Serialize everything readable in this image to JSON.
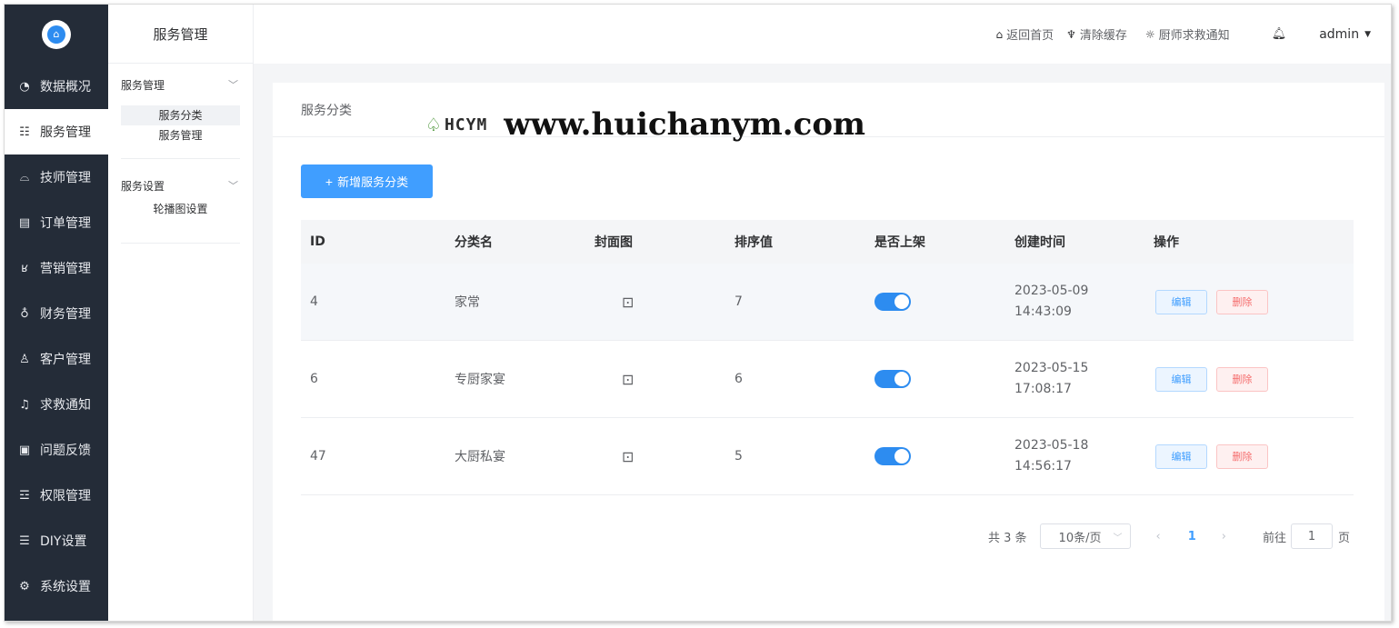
{
  "sidebar": {
    "items": [
      {
        "label": "数据概况",
        "icon": "pie-chart-icon"
      },
      {
        "label": "服务管理",
        "icon": "calendar-icon"
      },
      {
        "label": "技师管理",
        "icon": "technician-icon"
      },
      {
        "label": "订单管理",
        "icon": "order-icon"
      },
      {
        "label": "营销管理",
        "icon": "marketing-icon"
      },
      {
        "label": "财务管理",
        "icon": "money-bag-icon"
      },
      {
        "label": "客户管理",
        "icon": "users-icon"
      },
      {
        "label": "求救通知",
        "icon": "bell-icon"
      },
      {
        "label": "问题反馈",
        "icon": "feedback-icon"
      },
      {
        "label": "权限管理",
        "icon": "permission-icon"
      },
      {
        "label": "DIY设置",
        "icon": "diy-icon"
      },
      {
        "label": "系统设置",
        "icon": "gear-icon"
      }
    ],
    "active_index": 1
  },
  "subnav": {
    "title": "服务管理",
    "groups": [
      {
        "label": "服务管理",
        "links": [
          "服务分类",
          "服务管理"
        ]
      },
      {
        "label": "服务设置",
        "links": [
          "轮播图设置"
        ]
      }
    ]
  },
  "topbar": {
    "home": "返回首页",
    "clear_cache": "清除缓存",
    "sos_notice": "厨师求救通知",
    "user": "admin"
  },
  "page": {
    "card_title": "服务分类",
    "add_button": "新增服务分类",
    "watermark_mark": "HCYM",
    "watermark_url": "www.huichanym.com"
  },
  "table": {
    "headers": [
      "ID",
      "分类名",
      "封面图",
      "排序值",
      "是否上架",
      "创建时间",
      "操作"
    ],
    "rows": [
      {
        "id": "4",
        "name": "家常",
        "sort": "7",
        "on_shelf": true,
        "date": "2023-05-09",
        "time": "14:43:09"
      },
      {
        "id": "6",
        "name": "专厨家宴",
        "sort": "6",
        "on_shelf": true,
        "date": "2023-05-15",
        "time": "17:08:17"
      },
      {
        "id": "47",
        "name": "大厨私宴",
        "sort": "5",
        "on_shelf": true,
        "date": "2023-05-18",
        "time": "14:56:17"
      }
    ],
    "edit_label": "编辑",
    "delete_label": "删除"
  },
  "pagination": {
    "total": "共 3 条",
    "page_size": "10条/页",
    "current_page": "1",
    "goto_label": "前往",
    "goto_value": "1",
    "page_suffix": "页"
  },
  "colors": {
    "sidebar_bg": "#242c38",
    "primary": "#409eff",
    "danger": "#f56c6c"
  }
}
